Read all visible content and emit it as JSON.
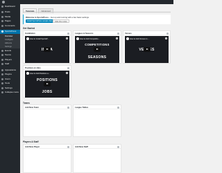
{
  "admin_bar": {
    "logo": "wordpress-icon"
  },
  "sidebar": {
    "items": [
      {
        "label": "Dashboard",
        "icon": "dashboard-icon"
      },
      {
        "label": "Posts",
        "icon": "pin-icon"
      },
      {
        "label": "Media",
        "icon": "media-icon"
      },
      {
        "label": "Pages",
        "icon": "page-icon"
      },
      {
        "label": "Comments",
        "icon": "comment-icon"
      },
      {
        "label": "SportsPress",
        "icon": "sportspress-icon",
        "active": true
      }
    ],
    "submenu": [
      "Overview",
      "Configure",
      "Add-ons",
      "Settings"
    ],
    "items_after": [
      {
        "label": "Events",
        "icon": "calendar-icon"
      },
      {
        "label": "Teams",
        "icon": "shield-icon"
      },
      {
        "label": "Players",
        "icon": "user-icon"
      },
      {
        "label": "Staff",
        "icon": "staff-icon"
      },
      {
        "label": "Appearance",
        "icon": "brush-icon"
      },
      {
        "label": "Plugins",
        "icon": "plugin-icon"
      },
      {
        "label": "Users",
        "icon": "users-icon"
      },
      {
        "label": "Tools",
        "icon": "wrench-icon"
      },
      {
        "label": "Settings",
        "icon": "settings-icon"
      },
      {
        "label": "Collapse menu",
        "icon": "collapse-icon"
      }
    ]
  },
  "tabs": [
    "Tutorials",
    "Advanced"
  ],
  "notice": {
    "title": "Welcome to SportsPress",
    "text": " – Get up and running with a few basic settings.",
    "primary": "Install SportsPress sample data",
    "secondary": "Hide this notice"
  },
  "sections": {
    "get_started": "Get Started",
    "teams": "Teams",
    "players_staff": "Players & Staff"
  },
  "videos": [
    {
      "widget": "Installation",
      "title": "How to Install SportsP...",
      "big1": "INSTA",
      "big2": "TION"
    },
    {
      "widget": "Leagues & Seasons",
      "title": "How to Add Competitio...",
      "big1": "COMPETITIONS",
      "big2": "SEASONS"
    },
    {
      "widget": "Venues",
      "title": "How to Add Venues to ...",
      "big1": "VENUES",
      "big2": ""
    },
    {
      "widget": "Positions & Jobs",
      "title": "How to Add Positions a...",
      "big1": "POSITIONS",
      "big2": "JOBS"
    }
  ],
  "team_widgets": [
    "Add New Team",
    "League Tables"
  ],
  "people_widgets": [
    "Add New Player",
    "Add New Staff"
  ]
}
